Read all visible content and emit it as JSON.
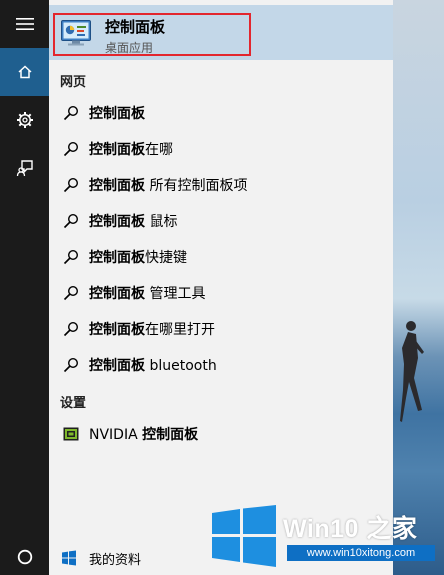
{
  "best_match": {
    "title": "控制面板",
    "subtitle": "桌面应用"
  },
  "sections": {
    "web": "网页",
    "settings": "设置"
  },
  "web_results": [
    {
      "bold": "控制面板",
      "rest": ""
    },
    {
      "bold": "控制面板",
      "rest": "在哪"
    },
    {
      "bold": "控制面板",
      "rest": " 所有控制面板项"
    },
    {
      "bold": "控制面板",
      "rest": " 鼠标"
    },
    {
      "bold": "控制面板",
      "rest": "快捷键"
    },
    {
      "bold": "控制面板",
      "rest": " 管理工具"
    },
    {
      "bold": "控制面板",
      "rest": "在哪里打开"
    },
    {
      "bold": "控制面板",
      "rest": " bluetooth"
    }
  ],
  "settings_results": [
    {
      "prefix": "NVIDIA ",
      "bold": "控制面板"
    }
  ],
  "bottom": {
    "label": "我的资料"
  },
  "watermark": {
    "brand": "Win10 之家",
    "url": "www.win10xitong.com"
  },
  "icons": {
    "menu": "hamburger-icon",
    "home": "home-icon",
    "settings": "gear-icon",
    "feedback": "feedback-icon",
    "cortana": "cortana-circle-icon",
    "search": "search-icon",
    "nvidia": "nvidia-app-icon",
    "windows": "windows-logo-icon"
  },
  "colors": {
    "rail": "#1b1b1b",
    "rail_active": "#1f5f8f",
    "panel": "#f2f2f2",
    "best_highlight": "#c3d7e8",
    "annotation_border": "#e3262e",
    "watermark_blue": "#0e6fc4"
  }
}
